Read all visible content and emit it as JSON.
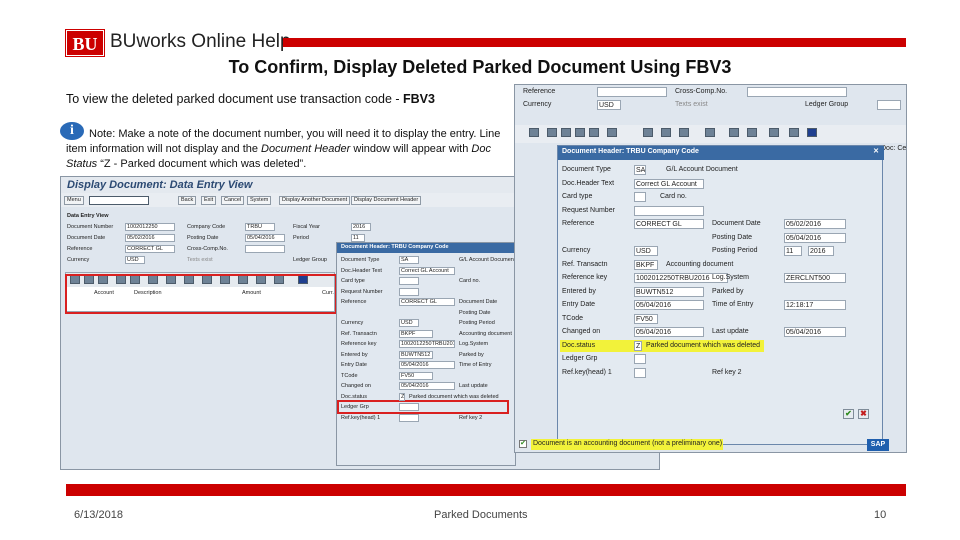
{
  "header": {
    "logo_mark": "BU",
    "logo_text": "BUworks Online Help"
  },
  "slide": {
    "title": "To Confirm, Display Deleted Parked Document Using FBV3",
    "intro_prefix": "To view the deleted parked document use transaction code - ",
    "intro_code": "FBV3",
    "note_icon": "i",
    "note_text_1": "Note:  Make a note of the document number, you will need it to display the entry. Line item information will not display and the ",
    "note_em_1": "Document Header",
    "note_text_2": " window will appear with ",
    "note_em_2": "Doc Status",
    "note_text_3": " “Z - Parked document which was deleted”."
  },
  "left_screen": {
    "title": "Display Document: Data Entry View",
    "menu_btn": "Menu",
    "buttons": [
      "Back",
      "Exit",
      "Cancel",
      "System",
      "Display Another Document",
      "Display Document Header"
    ],
    "section": "Data Entry View",
    "fields": [
      {
        "label": "Document Number",
        "value": "1002012250"
      },
      {
        "label": "Document Date",
        "value": "05/02/2016"
      },
      {
        "label": "Reference",
        "value": "CORRECT GL"
      },
      {
        "label": "Currency",
        "value": "USD"
      }
    ],
    "fields_right": [
      {
        "label": "Company Code",
        "value": "TRBU"
      },
      {
        "label": "Posting Date",
        "value": "05/04/2016"
      },
      {
        "label": "Cross-Comp.No.",
        "value": ""
      },
      {
        "label": "Texts exist",
        "value": ""
      }
    ],
    "fields_far": [
      {
        "label": "Fiscal Year",
        "value": "2016"
      },
      {
        "label": "Period",
        "value": "11"
      },
      {
        "label": "",
        "value": ""
      },
      {
        "label": "Ledger Group",
        "value": ""
      }
    ],
    "columns": [
      "Account",
      "Description",
      "Amount",
      "Curr."
    ]
  },
  "mid_dialog": {
    "title": "Document Header: TRBU Company Code",
    "rows": [
      {
        "label": "Document Type",
        "value": "SA",
        "extra": "G/L Account Document"
      },
      {
        "label": "Doc.Header Text",
        "value": "Correct GL Account",
        "extra": ""
      },
      {
        "label": "Card type",
        "value": "",
        "extra": "Card no."
      },
      {
        "label": "Request Number",
        "value": "",
        "extra": ""
      },
      {
        "label": "Reference",
        "value": "CORRECT GL",
        "extra": "Document Date"
      },
      {
        "label": "",
        "value": "",
        "extra": "Posting Date"
      },
      {
        "label": "Currency",
        "value": "USD",
        "extra": "Posting Period"
      },
      {
        "label": "Ref. Transactn",
        "value": "BKPF",
        "extra": "Accounting document"
      },
      {
        "label": "Reference key",
        "value": "1002012250TRBU2016",
        "extra": "Log.System"
      },
      {
        "label": "Entered by",
        "value": "BUWTN512",
        "extra": "Parked by"
      },
      {
        "label": "Entry Date",
        "value": "05/04/2016",
        "extra": "Time of Entry"
      },
      {
        "label": "TCode",
        "value": "FV50",
        "extra": ""
      },
      {
        "label": "Changed on",
        "value": "05/04/2016",
        "extra": "Last update"
      },
      {
        "label": "Doc.status",
        "value": "Z",
        "extra": "Parked document which was deleted"
      },
      {
        "label": "Ledger Grp",
        "value": "",
        "extra": ""
      },
      {
        "label": "Ref.key(head) 1",
        "value": "",
        "extra": "Ref key 2"
      }
    ]
  },
  "right_dialog": {
    "top_rows": [
      {
        "label": "Reference",
        "extra": "Cross-Comp.No."
      },
      {
        "label": "Currency",
        "value": "USD",
        "extra": "Texts exist",
        "far": "Ledger Group"
      }
    ],
    "title": "Document Header: TRBU Company Code",
    "side_text": "Doc: Ce",
    "rows": [
      {
        "label": "Document Type",
        "value": "SA",
        "extra": "G/L Account Document"
      },
      {
        "label": "Doc.Header Text",
        "value": "Correct GL Account"
      },
      {
        "label": "Card type",
        "value": "",
        "extra": "Card no."
      },
      {
        "label": "Request Number",
        "value": ""
      },
      {
        "label": "Reference",
        "value": "CORRECT GL",
        "extra": "Document Date",
        "extra_val": "05/02/2016"
      },
      {
        "label": "",
        "value": "",
        "extra": "Posting Date",
        "extra_val": "05/04/2016"
      },
      {
        "label": "Currency",
        "value": "USD",
        "extra": "Posting Period",
        "extra_val": "11",
        "extra_val2": "2016"
      },
      {
        "label": "Ref. Transactn",
        "value": "BKPF",
        "extra": "Accounting document"
      },
      {
        "label": "Reference key",
        "value": "1002012250TRBU2016",
        "extra": "Log.System",
        "extra_val": "ZERCLNT500"
      },
      {
        "label": "Entered by",
        "value": "BUWTN512",
        "extra": "Parked by"
      },
      {
        "label": "Entry Date",
        "value": "05/04/2016",
        "extra": "Time of Entry",
        "extra_val": "12:18:17"
      },
      {
        "label": "TCode",
        "value": "FV50"
      },
      {
        "label": "Changed on",
        "value": "05/04/2016",
        "extra": "Last update",
        "extra_val": "05/04/2016"
      },
      {
        "label": "Doc.status",
        "value": "Z",
        "extra": "Parked document which was deleted"
      },
      {
        "label": "Ledger Grp",
        "value": ""
      },
      {
        "label": "Ref.key(head) 1",
        "value": "",
        "extra": "Ref key 2"
      }
    ],
    "checkbox_label": "Document is an accounting document (not a preliminary one)",
    "brand": "SAP"
  },
  "footer": {
    "date": "6/13/2018",
    "center": "Parked Documents",
    "page": "10"
  },
  "colors": {
    "accent": "#cc0000",
    "sap_blue": "#3a6aa3",
    "highlight": "#f2f23a"
  }
}
